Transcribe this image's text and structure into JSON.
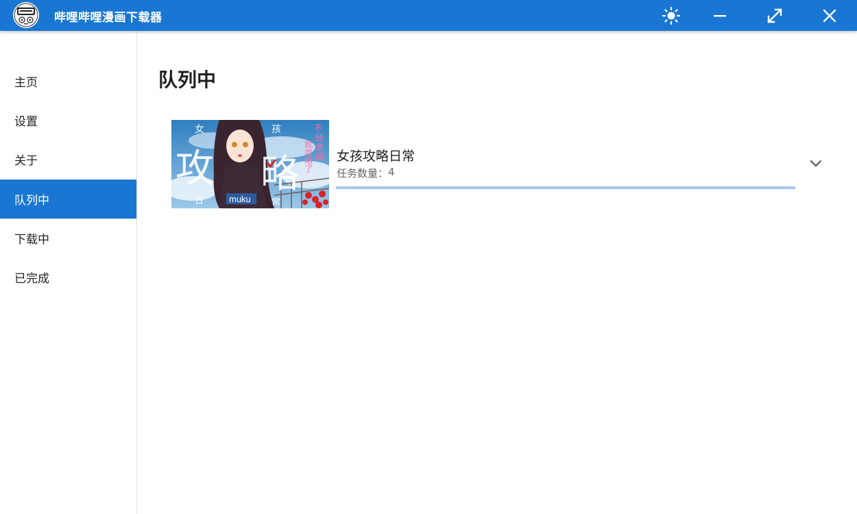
{
  "window": {
    "title": "哔哩哔哩漫画下载器",
    "logo_icon": "manga-logo-icon",
    "buttons": [
      "theme-toggle-icon",
      "minimize-icon",
      "maximize-icon",
      "close-icon"
    ]
  },
  "colors": {
    "accent": "#1976d2",
    "progress": "#a7c8e8"
  },
  "sidebar": {
    "items": [
      {
        "label": "主页",
        "active": false
      },
      {
        "label": "设置",
        "active": false
      },
      {
        "label": "关于",
        "active": false
      },
      {
        "label": "队列中",
        "active": true
      },
      {
        "label": "下载中",
        "active": false
      },
      {
        "label": "已完成",
        "active": false
      }
    ]
  },
  "main": {
    "title": "队列中",
    "tasks": [
      {
        "title": "女孩攻略日常",
        "count_label": "任务数量：",
        "count": "4",
        "progress": 1.0,
        "cover": {
          "chars": [
            "女",
            "孩",
            "攻",
            "略",
            "日",
            "常",
            "不",
            "经",
            "意",
            "间",
            "就",
            "攻",
            "略",
            "了"
          ],
          "author": "muku"
        },
        "expand_icon": "chevron-down-icon"
      }
    ]
  }
}
